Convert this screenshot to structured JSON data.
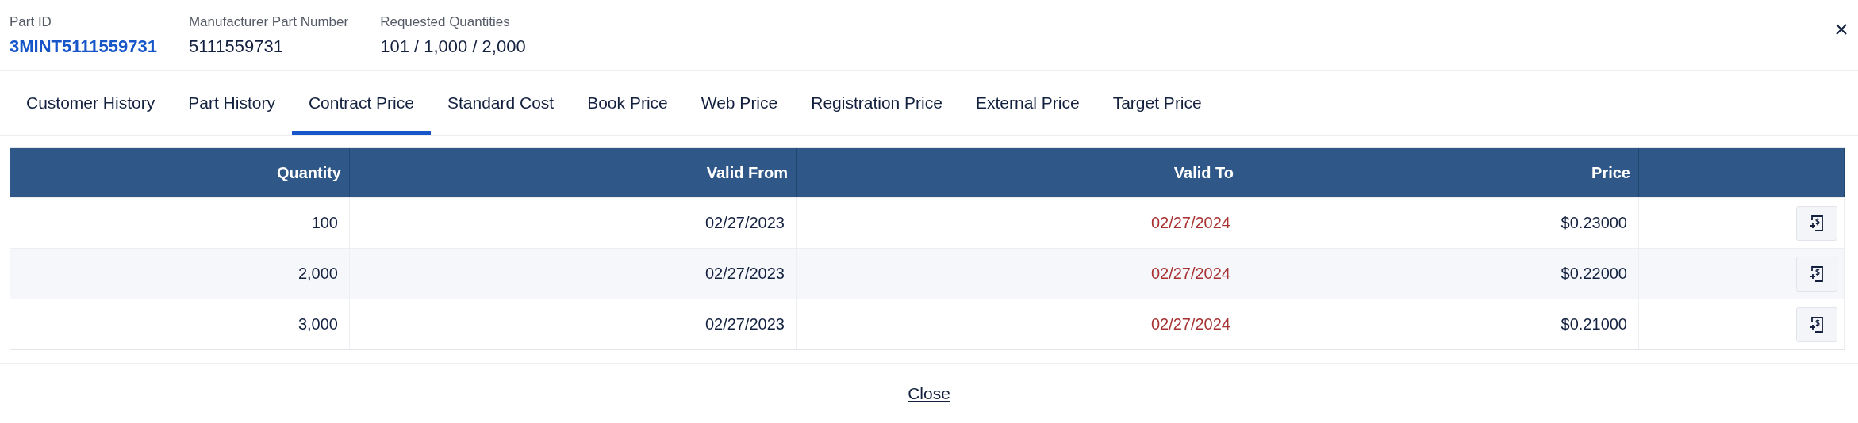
{
  "header": {
    "fields": [
      {
        "label": "Part ID",
        "value": "3MINT5111559731",
        "kind": "link"
      },
      {
        "label": "Manufacturer Part Number",
        "value": "5111559731",
        "kind": "text"
      },
      {
        "label": "Requested Quantities",
        "value": "101 / 1,000 / 2,000",
        "kind": "text"
      }
    ]
  },
  "tabs": [
    {
      "label": "Customer History",
      "selected": false
    },
    {
      "label": "Part History",
      "selected": false
    },
    {
      "label": "Contract Price",
      "selected": true
    },
    {
      "label": "Standard Cost",
      "selected": false
    },
    {
      "label": "Book Price",
      "selected": false
    },
    {
      "label": "Web Price",
      "selected": false
    },
    {
      "label": "Registration Price",
      "selected": false
    },
    {
      "label": "External Price",
      "selected": false
    },
    {
      "label": "Target Price",
      "selected": false
    }
  ],
  "table": {
    "columns": [
      "Quantity",
      "Valid From",
      "Valid To",
      "Price"
    ],
    "rows": [
      {
        "quantity": "100",
        "valid_from": "02/27/2023",
        "valid_to": "02/27/2024",
        "expired": true,
        "price": "$0.23000"
      },
      {
        "quantity": "2,000",
        "valid_from": "02/27/2023",
        "valid_to": "02/27/2024",
        "expired": true,
        "price": "$0.22000"
      },
      {
        "quantity": "3,000",
        "valid_from": "02/27/2023",
        "valid_to": "02/27/2024",
        "expired": true,
        "price": "$0.21000"
      }
    ]
  },
  "footer": {
    "close": "Close"
  }
}
